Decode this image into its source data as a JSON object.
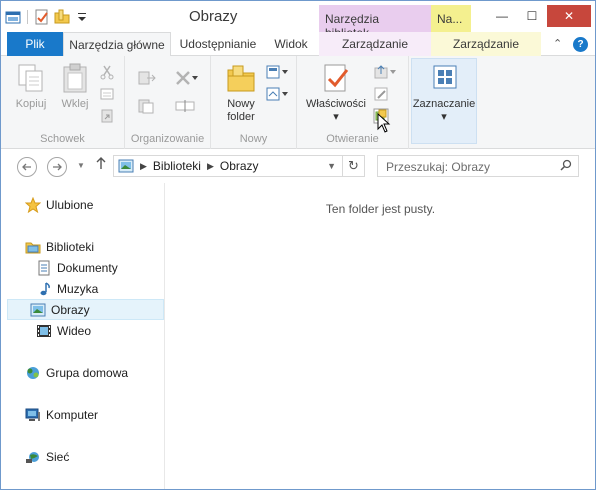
{
  "window": {
    "title": "Obrazy",
    "context_tab_library": "Narzędzia bibliotek",
    "context_tab_short": "Na...",
    "minimize": "—",
    "maximize": "☐",
    "close": "✕"
  },
  "tabs": {
    "file": "Plik",
    "home": "Narzędzia główne",
    "share": "Udostępnianie",
    "view": "Widok",
    "manage1": "Zarządzanie",
    "manage2": "Zarządzanie",
    "chevron": "⌃",
    "help": "?"
  },
  "ribbon": {
    "clipboard": {
      "label": "Schowek",
      "copy": "Kopiuj",
      "paste": "Wklej"
    },
    "organize": {
      "label": "Organizowanie"
    },
    "new": {
      "label": "Nowy",
      "new_folder_line1": "Nowy",
      "new_folder_line2": "folder"
    },
    "open": {
      "label": "Otwieranie",
      "properties": "Właściwości"
    },
    "select": {
      "select_label": "Zaznaczanie"
    }
  },
  "address": {
    "crumb1": "Biblioteki",
    "crumb2": "Obrazy",
    "search_placeholder": "Przeszukaj: Obrazy"
  },
  "navpane": {
    "favorites": "Ulubione",
    "libraries": "Biblioteki",
    "documents": "Dokumenty",
    "music": "Muzyka",
    "pictures": "Obrazy",
    "video": "Wideo",
    "homegroup": "Grupa domowa",
    "computer": "Komputer",
    "network": "Sieć"
  },
  "content": {
    "empty_message": "Ten folder jest pusty."
  }
}
